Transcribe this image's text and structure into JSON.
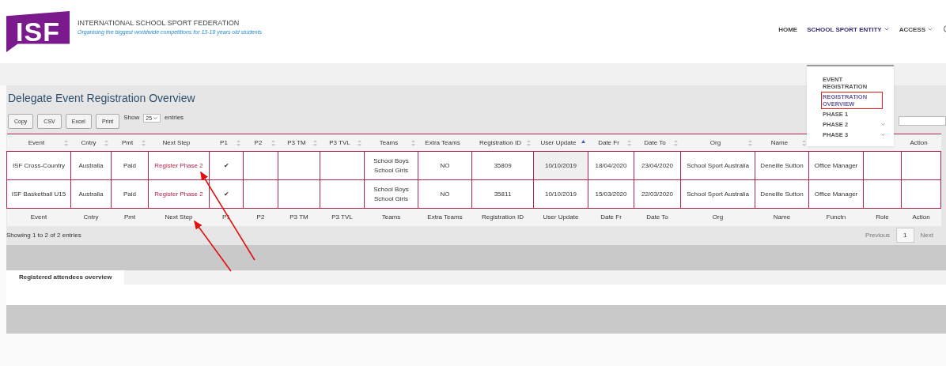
{
  "header": {
    "logo": "ISF",
    "org_name": "INTERNATIONAL SCHOOL SPORT FEDERATION",
    "tagline": "Organising the biggest worldwide competitions for 13-18 years old students"
  },
  "nav": [
    {
      "label": "HOME",
      "active": false,
      "caret": false
    },
    {
      "label": "SCHOOL SPORT ENTITY",
      "active": true,
      "caret": true
    },
    {
      "label": "ACCESS",
      "active": false,
      "caret": true
    }
  ],
  "dropdown": [
    {
      "label": "EVENT REGISTRATION",
      "selected": false,
      "caret": false
    },
    {
      "label": "REGISTRATION OVERVIEW",
      "selected": true,
      "caret": false
    },
    {
      "label": "PHASE 1",
      "selected": false,
      "caret": false
    },
    {
      "label": "PHASE 2",
      "selected": false,
      "caret": true
    },
    {
      "label": "PHASE 3",
      "selected": false,
      "caret": true
    }
  ],
  "title": "Delegate Event Registration Overview",
  "export_buttons": [
    "Copy",
    "CSV",
    "Excel",
    "Print"
  ],
  "length": {
    "prefix": "Show",
    "value": "25",
    "suffix": "entries"
  },
  "table": {
    "columns": [
      {
        "label": "Event",
        "kind": "text",
        "sortable": true,
        "sorted": false
      },
      {
        "label": "Cntry",
        "kind": "text",
        "sortable": true,
        "sorted": false
      },
      {
        "label": "Pmt",
        "kind": "text",
        "sortable": true,
        "sorted": false
      },
      {
        "label": "Next Step",
        "kind": "link",
        "sortable": false
      },
      {
        "label": "P1",
        "kind": "text",
        "sortable": true,
        "sorted": false
      },
      {
        "label": "P2",
        "kind": "text",
        "sortable": true,
        "sorted": false
      },
      {
        "label": "P3 TM",
        "kind": "text",
        "sortable": true,
        "sorted": false
      },
      {
        "label": "P3 TVL",
        "kind": "text",
        "sortable": true,
        "sorted": false
      },
      {
        "label": "Teams",
        "kind": "text",
        "sortable": true,
        "sorted": false
      },
      {
        "label": "Extra Teams",
        "kind": "text",
        "sortable": false
      },
      {
        "label": "Registration ID",
        "kind": "text",
        "sortable": true,
        "sorted": false
      },
      {
        "label": "User Update",
        "kind": "text",
        "sortable": true,
        "sorted": true
      },
      {
        "label": "Date Fr",
        "kind": "text",
        "sortable": true,
        "sorted": false
      },
      {
        "label": "Date To",
        "kind": "text",
        "sortable": true,
        "sorted": false
      },
      {
        "label": "Org",
        "kind": "text",
        "sortable": true,
        "sorted": false
      },
      {
        "label": "Name",
        "kind": "text",
        "sortable": true,
        "sorted": false
      },
      {
        "kind": "text"
      },
      {
        "kind": "text"
      },
      {
        "label": "Action",
        "kind": "text",
        "sortable": false
      }
    ],
    "rows": [
      {
        "cells": [
          "ISF Cross-Country",
          "Australia",
          "Paid",
          "Register Phase 2",
          "✔",
          "",
          "",
          "",
          "School Boys\nSchool Girls",
          "NO",
          "35809",
          "10/10/2019",
          "18/04/2020",
          "23/04/2020",
          "School Sport Australia",
          "Deneille Sutton",
          "Office Manager",
          "",
          ""
        ]
      },
      {
        "cells": [
          "ISF Basketball U15",
          "Australia",
          "Paid",
          "Register Phase 2",
          "✔",
          "",
          "",
          "",
          "School Boys\nSchool Girls",
          "NO",
          "35811",
          "10/10/2019",
          "15/03/2020",
          "22/03/2020",
          "School Sport Australia",
          "Deneille Sutton",
          "Office Manager",
          "",
          ""
        ]
      }
    ],
    "footer": [
      "Event",
      "Cntry",
      "Pmt",
      "Next Step",
      "P1",
      "P2",
      "P3 TM",
      "P3 TVL",
      "Teams",
      "Extra Teams",
      "Registration ID",
      "User Update",
      "Date Fr",
      "Date To",
      "Org",
      "Name",
      "Functn",
      "Role",
      "Action"
    ]
  },
  "info": "Showing 1 to 2 of 2 entries",
  "pagination": {
    "previous": "Previous",
    "pages": [
      {
        "label": "1",
        "selected": true
      }
    ],
    "next": "Next"
  },
  "tabs": [
    {
      "label": "Registered attendees overview",
      "selected": true
    }
  ]
}
